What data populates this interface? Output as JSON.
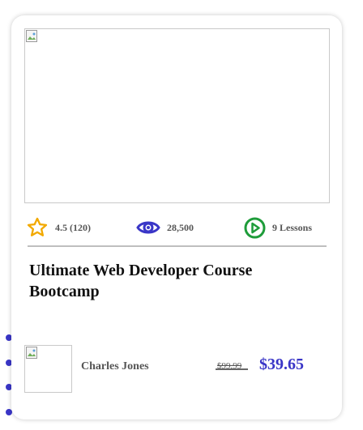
{
  "course": {
    "rating": "4.5 (120)",
    "views": "28,500",
    "lessons": "9 Lessons",
    "title": "Ultimate Web Developer Course Bootcamp",
    "author": "Charles Jones",
    "old_price": "$99.99",
    "new_price": "$39.65"
  },
  "icons": {
    "rating": "star-icon",
    "views": "eye-icon",
    "lessons": "play-circle-icon"
  },
  "colors": {
    "star": "#f2a900",
    "eye": "#3a36c7",
    "play": "#1e9c3a",
    "price": "#3a36c7",
    "bullet": "#3a36c7"
  }
}
